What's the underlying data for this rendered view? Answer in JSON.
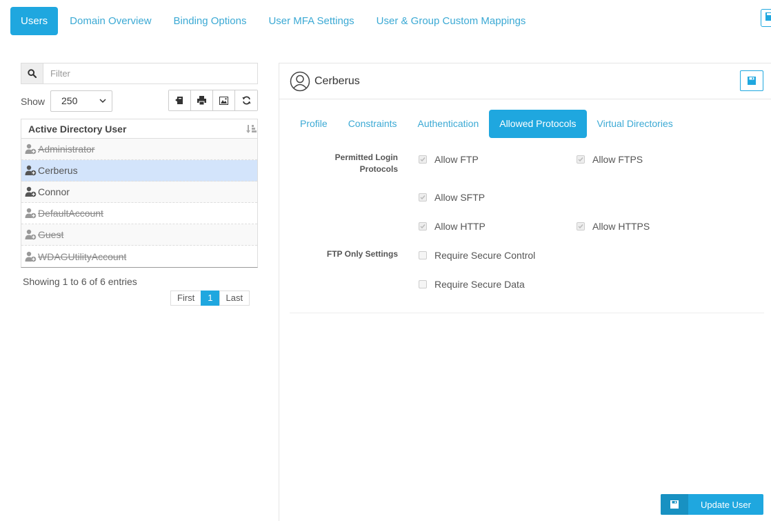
{
  "top_nav": {
    "tabs": [
      {
        "label": "Users",
        "active": true
      },
      {
        "label": "Domain Overview",
        "active": false
      },
      {
        "label": "Binding Options",
        "active": false
      },
      {
        "label": "User MFA Settings",
        "active": false
      },
      {
        "label": "User & Group Custom Mappings",
        "active": false
      }
    ]
  },
  "left_panel": {
    "filter_placeholder": "Filter",
    "show_label": "Show",
    "page_size": "250",
    "table_header": "Active Directory User",
    "users": [
      {
        "name": "Administrator",
        "disabled": true,
        "selected": false
      },
      {
        "name": "Cerberus",
        "disabled": false,
        "selected": true
      },
      {
        "name": "Connor",
        "disabled": false,
        "selected": false
      },
      {
        "name": "DefaultAccount",
        "disabled": true,
        "selected": false
      },
      {
        "name": "Guest",
        "disabled": true,
        "selected": false
      },
      {
        "name": "WDAGUtilityAccount",
        "disabled": true,
        "selected": false
      }
    ],
    "entries_info": "Showing 1 to 6 of 6 entries",
    "pager": {
      "first": "First",
      "current": "1",
      "last": "Last"
    }
  },
  "right_panel": {
    "user_name": "Cerberus",
    "sub_tabs": [
      {
        "label": "Profile",
        "active": false
      },
      {
        "label": "Constraints",
        "active": false
      },
      {
        "label": "Authentication",
        "active": false
      },
      {
        "label": "Allowed Protocols",
        "active": true
      },
      {
        "label": "Virtual Directories",
        "active": false
      }
    ],
    "permitted_label_line1": "Permitted Login",
    "permitted_label_line2": "Protocols",
    "ftp_only_label": "FTP Only Settings",
    "options": {
      "allow_ftp": {
        "label": "Allow FTP",
        "checked": true
      },
      "allow_ftps": {
        "label": "Allow FTPS",
        "checked": true
      },
      "allow_sftp": {
        "label": "Allow SFTP",
        "checked": true
      },
      "allow_http": {
        "label": "Allow HTTP",
        "checked": true
      },
      "allow_https": {
        "label": "Allow HTTPS",
        "checked": true
      },
      "require_secure_control": {
        "label": "Require Secure Control",
        "checked": false
      },
      "require_secure_data": {
        "label": "Require Secure Data",
        "checked": false
      }
    },
    "update_button": "Update User"
  },
  "colors": {
    "accent": "#1fa7df",
    "selected_row": "#d3e4fb"
  }
}
